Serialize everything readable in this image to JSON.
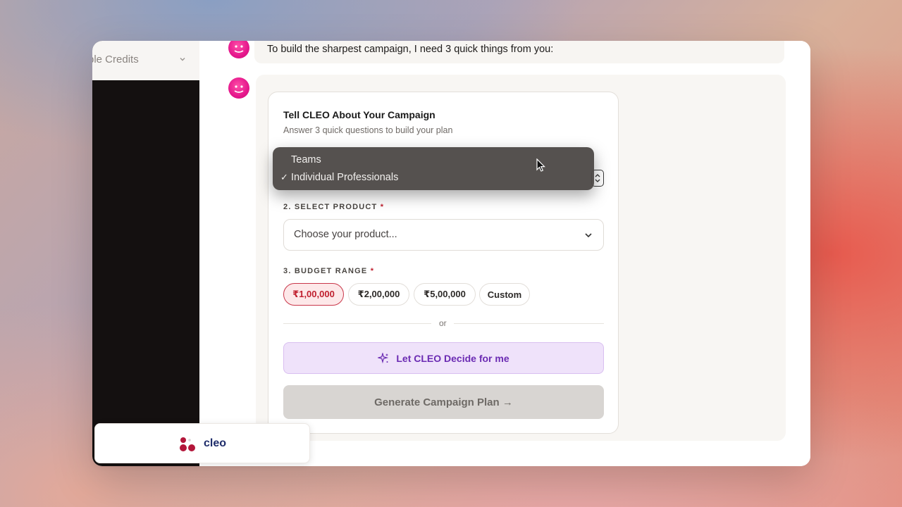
{
  "sidebar": {
    "credits_label": "ble Credits"
  },
  "chat": {
    "intro_message": "To build the sharpest campaign, I need 3 quick things from you:"
  },
  "card": {
    "title": "Tell CLEO About Your Campaign",
    "subtitle": "Answer 3 quick questions to build your plan",
    "audience_dropdown": {
      "options": [
        "Teams",
        "Individual Professionals"
      ],
      "selected": "Individual Professionals",
      "check_mark": "✓"
    },
    "product": {
      "label": "2. SELECT PRODUCT",
      "required_mark": "*",
      "placeholder": "Choose your product..."
    },
    "budget": {
      "label": "3. BUDGET RANGE",
      "required_mark": "*",
      "options": [
        "₹1,00,000",
        "₹2,00,000",
        "₹5,00,000",
        "Custom"
      ],
      "selected": "₹1,00,000"
    },
    "or_text": "or",
    "let_cleo_button": "Let CLEO Decide for me",
    "generate_button": "Generate Campaign Plan →"
  },
  "brand": {
    "name": "cleo"
  },
  "colors": {
    "accent_pink": "#e5178c",
    "selected_red": "#c0202f",
    "purple": "#6b2bb3",
    "sidebar_dark": "#141010"
  },
  "icons": [
    "chevron-down-icon",
    "sparkle-icon",
    "cursor-icon",
    "select-stepper-icon",
    "cleo-logo-icon",
    "avatar-icon"
  ]
}
